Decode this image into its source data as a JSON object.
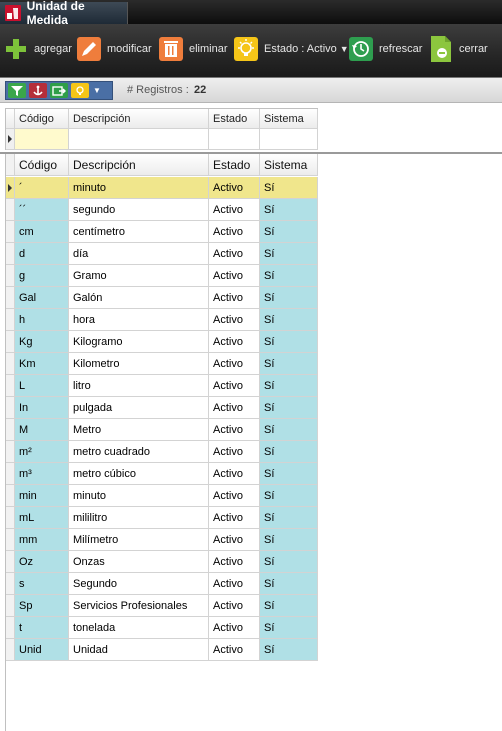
{
  "window": {
    "title": "Unidad de Medida"
  },
  "toolbar": {
    "add_label": "agregar",
    "edit_label": "modificar",
    "delete_label": "eliminar",
    "status_label": "Estado : Activo",
    "refresh_label": "refrescar",
    "close_label": "cerrar"
  },
  "subbar": {
    "records_label": "# Registros :",
    "records_count": "22"
  },
  "columns": {
    "code": "Código",
    "description": "Descripción",
    "status": "Estado",
    "system": "Sistema"
  },
  "rows": [
    {
      "code": "´",
      "description": "minuto",
      "status": "Activo",
      "system": "Sí"
    },
    {
      "code": "´´",
      "description": "segundo",
      "status": "Activo",
      "system": "Sí"
    },
    {
      "code": "cm",
      "description": "centímetro",
      "status": "Activo",
      "system": "Sí"
    },
    {
      "code": "d",
      "description": "día",
      "status": "Activo",
      "system": "Sí"
    },
    {
      "code": "g",
      "description": "Gramo",
      "status": "Activo",
      "system": "Sí"
    },
    {
      "code": "Gal",
      "description": "Galón",
      "status": "Activo",
      "system": "Sí"
    },
    {
      "code": "h",
      "description": "hora",
      "status": "Activo",
      "system": "Sí"
    },
    {
      "code": "Kg",
      "description": "Kilogramo",
      "status": "Activo",
      "system": "Sí"
    },
    {
      "code": "Km",
      "description": "Kilometro",
      "status": "Activo",
      "system": "Sí"
    },
    {
      "code": "L",
      "description": "litro",
      "status": "Activo",
      "system": "Sí"
    },
    {
      "code": "In",
      "description": "pulgada",
      "status": "Activo",
      "system": "Sí"
    },
    {
      "code": "M",
      "description": "Metro",
      "status": "Activo",
      "system": "Sí"
    },
    {
      "code": "m²",
      "description": "metro cuadrado",
      "status": "Activo",
      "system": "Sí"
    },
    {
      "code": "m³",
      "description": "metro cúbico",
      "status": "Activo",
      "system": "Sí"
    },
    {
      "code": "min",
      "description": "minuto",
      "status": "Activo",
      "system": "Sí"
    },
    {
      "code": "mL",
      "description": "mililitro",
      "status": "Activo",
      "system": "Sí"
    },
    {
      "code": "mm",
      "description": "Milímetro",
      "status": "Activo",
      "system": "Sí"
    },
    {
      "code": "Oz",
      "description": "Onzas",
      "status": "Activo",
      "system": "Sí"
    },
    {
      "code": "s",
      "description": "Segundo",
      "status": "Activo",
      "system": "Sí"
    },
    {
      "code": "Sp",
      "description": "Servicios Profesionales",
      "status": "Activo",
      "system": "Sí"
    },
    {
      "code": "t",
      "description": "tonelada",
      "status": "Activo",
      "system": "Sí"
    },
    {
      "code": "Unid",
      "description": "Unidad",
      "status": "Activo",
      "system": "Sí"
    }
  ],
  "icons": {
    "add": "plus-icon",
    "edit": "pencil-icon",
    "delete": "trash-icon",
    "status": "lightbulb-icon",
    "refresh": "refresh-clock-icon",
    "close": "close-document-icon"
  },
  "colors": {
    "code_column": "#b0e0e6",
    "selected_row": "#f0e68c",
    "toolbar": "#2a2a2a"
  }
}
